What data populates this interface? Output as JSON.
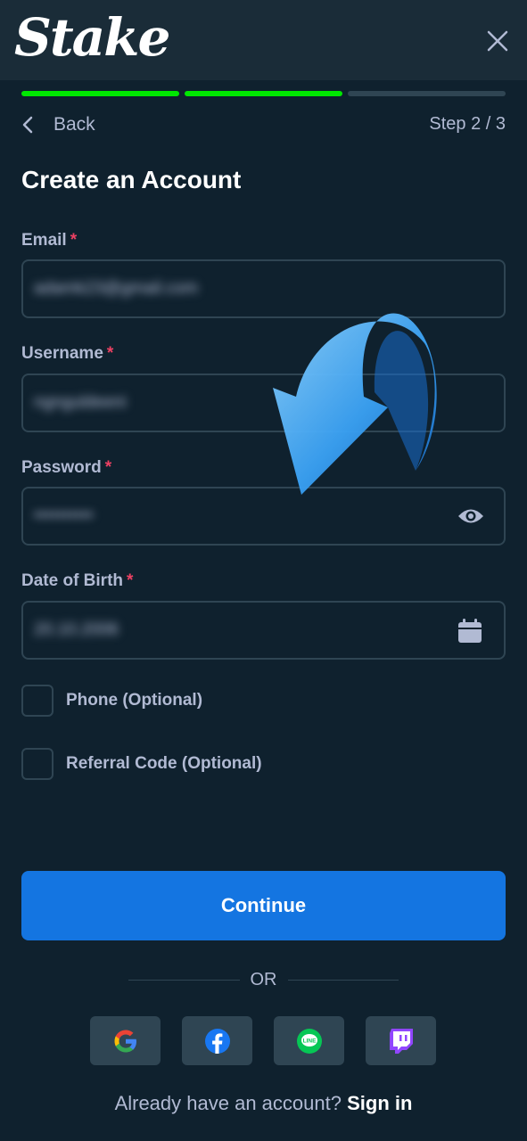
{
  "header": {
    "logo": "Stake",
    "close_icon": "close-icon"
  },
  "progress": {
    "current_step": 2,
    "total_steps": 3
  },
  "nav": {
    "back_label": "Back",
    "step_label": "Step 2 / 3"
  },
  "form": {
    "title": "Create an Account",
    "required_marker": "*",
    "email": {
      "label": "Email",
      "value": "adamk23@gmail.com"
    },
    "username": {
      "label": "Username",
      "value": "ngnguldeeni"
    },
    "password": {
      "label": "Password",
      "value": "••••••••••",
      "icon": "eye-icon"
    },
    "dob": {
      "label": "Date of Birth",
      "value": "20.10.2006",
      "icon": "calendar-icon"
    },
    "phone_label": "Phone (Optional)",
    "referral_label": "Referral Code (Optional)"
  },
  "actions": {
    "continue_label": "Continue",
    "or_label": "OR",
    "socials": [
      "google-icon",
      "facebook-icon",
      "line-icon",
      "twitch-icon"
    ]
  },
  "footer": {
    "prompt": "Already have an account?",
    "signin_label": "Sign in"
  },
  "colors": {
    "background": "#0f212e",
    "header": "#1a2c38",
    "accent_green": "#00e701",
    "primary_blue": "#1475e1",
    "required_red": "#ed4163"
  }
}
